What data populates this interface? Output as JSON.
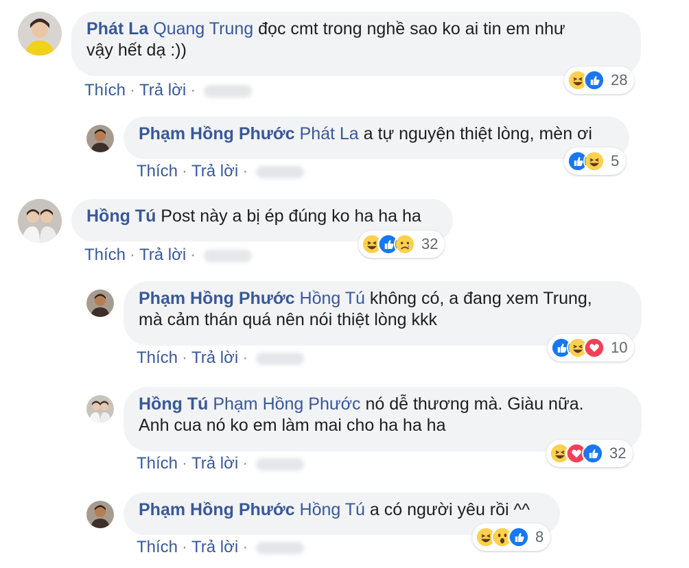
{
  "comments": [
    {
      "author": "Phát La",
      "mention": "Quang Trung",
      "text_line1": " đọc cmt trong nghề sao ko ai tin em như",
      "text_line2": "vậy hết dạ :))",
      "like_label": "Thích",
      "reply_label": "Trả lời",
      "reaction_count": "28",
      "reaction_icons": [
        "haha-icon",
        "like-icon"
      ]
    },
    {
      "author": "Phạm Hồng Phước",
      "mention": "Phát La",
      "text_line1": " a tự nguyện thiệt lòng, mèn ơi",
      "like_label": "Thích",
      "reply_label": "Trả lời",
      "reaction_count": "5",
      "reaction_icons": [
        "like-icon",
        "haha-icon"
      ]
    },
    {
      "author": "Hồng Tú",
      "text_line1": " Post này a bị ép đúng ko ha ha ha",
      "like_label": "Thích",
      "reply_label": "Trả lời",
      "reaction_count": "32",
      "reaction_icons": [
        "haha-icon",
        "like-icon",
        "sad-icon"
      ]
    },
    {
      "author": "Phạm Hồng Phước",
      "mention": "Hồng Tú",
      "text_line1": " không có, a đang xem Trung,",
      "text_line2": "mà cảm thán quá nên nói thiệt lòng kkk",
      "like_label": "Thích",
      "reply_label": "Trả lời",
      "reaction_count": "10",
      "reaction_icons": [
        "like-icon",
        "haha-icon",
        "love-icon"
      ]
    },
    {
      "author": "Hồng Tú",
      "mention": "Phạm Hồng Phước",
      "text_line1": " nó dễ thương mà. Giàu nữa.",
      "text_line2": "Anh cua nó ko em làm mai cho ha ha ha",
      "like_label": "Thích",
      "reply_label": "Trả lời",
      "reaction_count": "32",
      "reaction_icons": [
        "haha-icon",
        "love-icon",
        "like-icon"
      ]
    },
    {
      "author": "Phạm Hồng Phước",
      "mention": "Hồng Tú",
      "text_line1": " a có người yêu rồi ^^",
      "like_label": "Thích",
      "reply_label": "Trả lời",
      "reaction_count": "8",
      "reaction_icons": [
        "haha-icon",
        "wow-icon",
        "like-icon"
      ]
    }
  ],
  "colors": {
    "link": "#385898",
    "bubble": "#f2f3f5",
    "text": "#1c1e21",
    "meta": "#90949c",
    "like_blue": "#1877f2",
    "love_red": "#f33e58",
    "emoji_yellow": "#fdd04e"
  }
}
